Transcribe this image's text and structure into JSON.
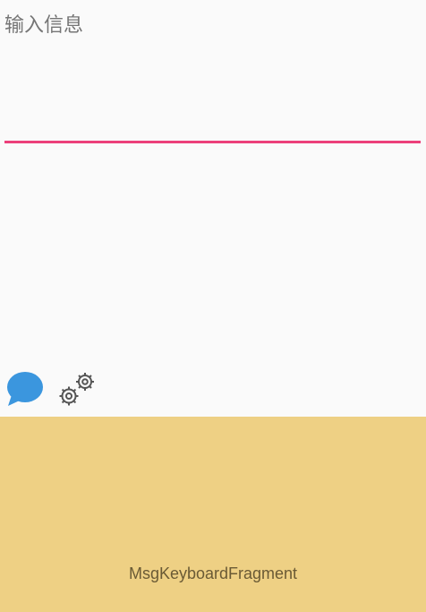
{
  "input": {
    "placeholder": "输入信息",
    "value": ""
  },
  "toolbar": {
    "chat_icon": "speech-bubble-icon",
    "settings_icon": "gears-icon"
  },
  "fragment": {
    "label": "MsgKeyboardFragment"
  },
  "colors": {
    "accent": "#ec407a",
    "chat_icon": "#3b96de",
    "panel_background": "#eed084",
    "screen_background": "#fafafa"
  }
}
